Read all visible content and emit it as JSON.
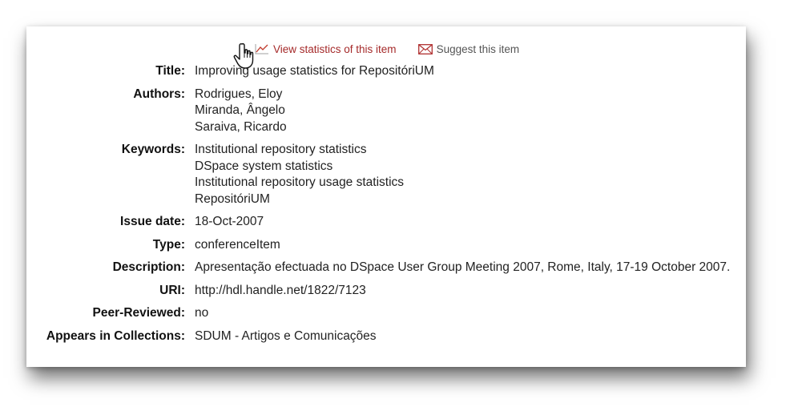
{
  "actions": {
    "stats_label": "View statistics of this item",
    "suggest_label": "Suggest this item"
  },
  "item": {
    "title_label": "Title:",
    "title": "Improving usage statistics for RepositóriUM",
    "authors_label": "Authors:",
    "authors": [
      "Rodrigues, Eloy",
      "Miranda, Ângelo",
      "Saraiva, Ricardo"
    ],
    "keywords_label": "Keywords:",
    "keywords": [
      "Institutional repository statistics",
      "DSpace system statistics",
      "Institutional repository usage statistics",
      "RepositóriUM"
    ],
    "issue_date_label": "Issue date:",
    "issue_date": "18-Oct-2007",
    "type_label": "Type:",
    "type": "conferenceItem",
    "description_label": "Description:",
    "description": "Apresentação efectuada no DSpace User Group Meeting 2007, Rome, Italy, 17-19 October 2007.",
    "uri_label": "URI:",
    "uri": "http://hdl.handle.net/1822/7123",
    "peer_reviewed_label": "Peer-Reviewed:",
    "peer_reviewed": "no",
    "collections_label": "Appears in Collections:",
    "collections": "SDUM - Artigos e Comunicações"
  },
  "colors": {
    "stats_link": "#a52a2a",
    "muted_value": "#5a5a5a"
  }
}
